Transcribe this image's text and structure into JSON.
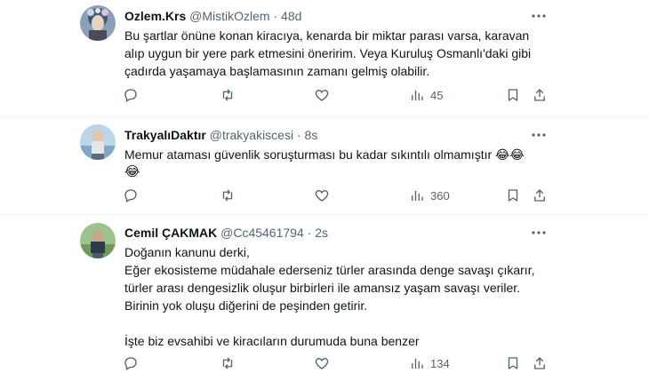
{
  "tweets": [
    {
      "name": "Ozlem.Krs",
      "handle": "@MistikOzlem",
      "separator": "·",
      "time": "48d",
      "lines": [
        "Bu şartlar önüne konan kiracıya, kenarda bir miktar parası varsa, karavan",
        "alıp uygun bir yere park etmesini öneririm. Veya Kuruluş Osmanlı'daki gibi",
        "çadırda yaşamaya başlamasının zamanı gelmiş olabilir."
      ],
      "views": "45"
    },
    {
      "name": "TrakyalıDaktır",
      "handle": "@trakyakiscesi",
      "separator": "·",
      "time": "8s",
      "lines": [
        "Memur ataması güvenlik soruşturması bu kadar sıkıntılı olmamıştır 😂😂",
        "😂"
      ],
      "views": "360"
    },
    {
      "name": "Cemil ÇAKMAK",
      "handle": "@Cc45461794",
      "separator": "·",
      "time": "2s",
      "lines": [
        "Doğanın kanunu derki,",
        "Eğer ekosisteme müdahale ederseniz türler arasında denge savaşı çıkarır,",
        "türler arası dengesizlik oluşur birbirleri ile amansız yaşam savaşı veriler.",
        "Birinin yok oluşu diğerini de peşinden getirir.",
        "",
        "İşte biz evsahibi ve kiracıların durumuda buna benzer"
      ],
      "views": "134"
    }
  ],
  "icons": {
    "reply": "reply-icon",
    "retweet": "retweet-icon",
    "like": "heart-icon",
    "views": "views-icon",
    "bookmark": "bookmark-icon",
    "more": "more-icon"
  },
  "colors": {
    "text": "#0f1419",
    "muted": "#536471",
    "divider": "#eff3f4"
  }
}
